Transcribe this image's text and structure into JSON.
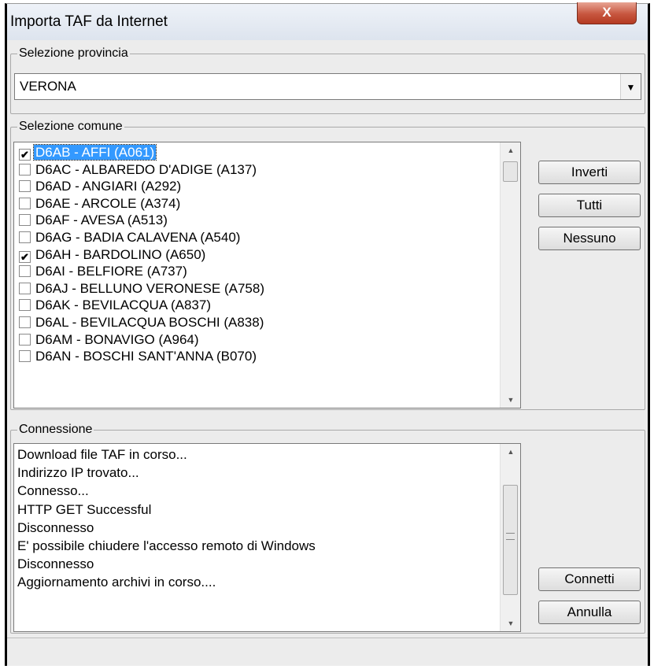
{
  "window": {
    "title": "Importa TAF da Internet",
    "close_glyph": "X"
  },
  "provincia": {
    "group_label": "Selezione provincia",
    "selected_value": "VERONA"
  },
  "comune": {
    "group_label": "Selezione comune",
    "items": [
      {
        "label": "D6AB - AFFI (A061)",
        "checked": true,
        "selected": true
      },
      {
        "label": "D6AC - ALBAREDO D'ADIGE (A137)",
        "checked": false
      },
      {
        "label": "D6AD - ANGIARI (A292)",
        "checked": false
      },
      {
        "label": "D6AE - ARCOLE (A374)",
        "checked": false
      },
      {
        "label": "D6AF - AVESA (A513)",
        "checked": false
      },
      {
        "label": "D6AG - BADIA CALAVENA (A540)",
        "checked": false
      },
      {
        "label": "D6AH - BARDOLINO (A650)",
        "checked": true
      },
      {
        "label": "D6AI - BELFIORE (A737)",
        "checked": false
      },
      {
        "label": "D6AJ - BELLUNO VERONESE (A758)",
        "checked": false
      },
      {
        "label": "D6AK - BEVILACQUA (A837)",
        "checked": false
      },
      {
        "label": "D6AL - BEVILACQUA BOSCHI (A838)",
        "checked": false
      },
      {
        "label": "D6AM - BONAVIGO (A964)",
        "checked": false
      },
      {
        "label": "D6AN - BOSCHI SANT'ANNA (B070)",
        "checked": false
      }
    ],
    "buttons": {
      "inverti": "Inverti",
      "tutti": "Tutti",
      "nessuno": "Nessuno"
    }
  },
  "connessione": {
    "group_label": "Connessione",
    "log_lines": [
      "Download file TAF in corso...",
      "Indirizzo IP trovato...",
      "Connesso...",
      "HTTP GET Successful",
      "Disconnesso",
      "E' possibile chiudere l'accesso remoto di Windows",
      "Disconnesso",
      "Aggiornamento archivi in corso...."
    ],
    "buttons": {
      "connetti": "Connetti",
      "annulla": "Annulla"
    }
  },
  "icons": {
    "combo_arrow": "chevron-down-icon",
    "scroll_up": "scroll-up-icon",
    "scroll_down": "scroll-down-icon",
    "close": "close-icon",
    "check": "checkmark-icon"
  },
  "colors": {
    "selection": "#3399ff",
    "close_button": "#c7563f",
    "dialog_bg": "#ececec"
  }
}
